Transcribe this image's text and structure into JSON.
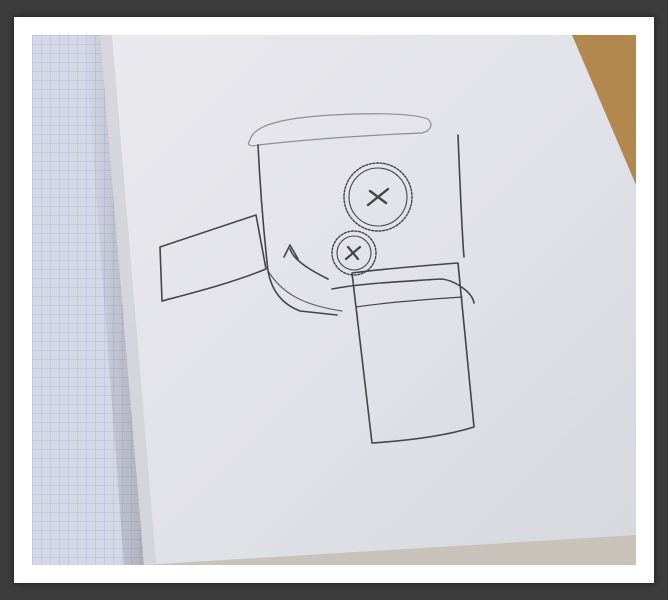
{
  "image": {
    "subject": "pencil-sketch-on-notebook-paper",
    "colors": {
      "outer_background": "#3c3c3c",
      "frame": "#ffffff",
      "paper": "#ececf1",
      "grid_paper": "#dcdfee",
      "grid_lines": "#a9a6d8",
      "table_wood": "#c8a56e",
      "pencil": "#2b2b2f"
    }
  }
}
